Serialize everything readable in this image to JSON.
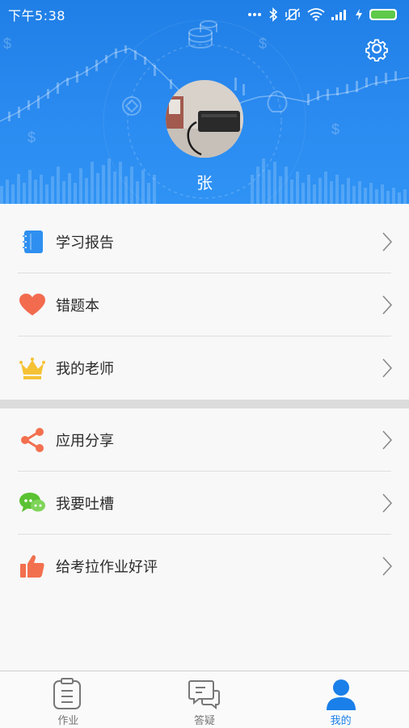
{
  "status_bar": {
    "time": "下午5:38"
  },
  "profile": {
    "name": "张"
  },
  "menu_group_1": [
    {
      "label": "学习报告",
      "icon": "notebook-icon",
      "icon_color": "#2f8ff0"
    },
    {
      "label": "错题本",
      "icon": "heart-icon",
      "icon_color": "#f26b4f"
    },
    {
      "label": "我的老师",
      "icon": "crown-icon",
      "icon_color": "#f5c235"
    }
  ],
  "menu_group_2": [
    {
      "label": "应用分享",
      "icon": "share-icon",
      "icon_color": "#f2704e"
    },
    {
      "label": "我要吐槽",
      "icon": "chat-bubbles-icon",
      "icon_color": "#5ac232"
    },
    {
      "label": "给考拉作业好评",
      "icon": "thumbs-up-icon",
      "icon_color": "#f2704e"
    }
  ],
  "tabs": [
    {
      "label": "作业",
      "icon": "clipboard-icon",
      "active": false
    },
    {
      "label": "答疑",
      "icon": "chat-icon",
      "active": false
    },
    {
      "label": "我的",
      "icon": "person-icon",
      "active": true
    }
  ],
  "colors": {
    "header_blue": "#2a8af0",
    "active_tab": "#1a7fe8",
    "battery": "#5ec94a"
  }
}
